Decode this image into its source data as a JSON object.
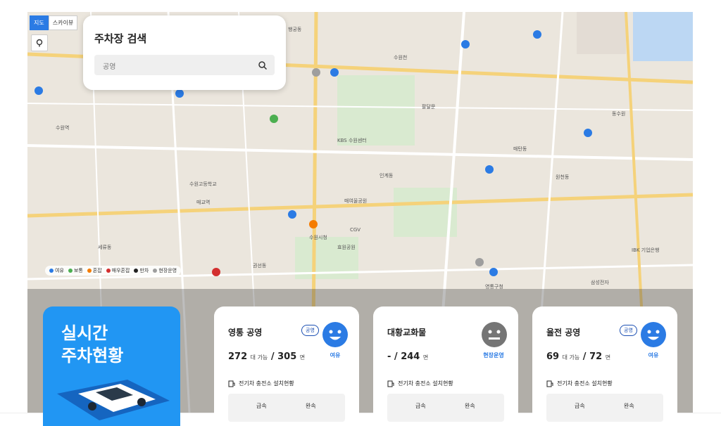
{
  "map_type": {
    "map": "지도",
    "skyview": "스카이뷰"
  },
  "search": {
    "title": "주차장 검색",
    "placeholder": "공영"
  },
  "legend": [
    {
      "label": "여유",
      "color": "#2b7be4"
    },
    {
      "label": "보통",
      "color": "#4caf50"
    },
    {
      "label": "혼잡",
      "color": "#f57c00"
    },
    {
      "label": "매우혼잡",
      "color": "#d32f2f"
    },
    {
      "label": "만차",
      "color": "#222222"
    },
    {
      "label": "현장운영",
      "color": "#9e9e9e"
    }
  ],
  "map_labels": [
    "행궁동",
    "수원천",
    "수원시청",
    "KBS 수원센터",
    "매교역",
    "수원역",
    "인계동",
    "효원공원",
    "매탄동",
    "삼성전자",
    "원천동",
    "팔달문",
    "수원고등학교",
    "매여울공원",
    "세류동",
    "권선동",
    "영통구청",
    "IBK 기업은행",
    "동수원",
    "CGV"
  ],
  "hero": {
    "line1": "실시간",
    "line2": "주차현황"
  },
  "cards": [
    {
      "name": "영통 공영",
      "badge": "공영",
      "available": "272",
      "total": "305",
      "available_unit": "대 가능",
      "total_unit": "면",
      "status": "여유",
      "status_color": "#2b7be4",
      "ev_label": "전기차 충전소 설치현황",
      "col1": "급속",
      "col2": "완속"
    },
    {
      "name": "대황교화물",
      "badge": "",
      "available": "-",
      "total": "244",
      "available_unit": "",
      "total_unit": "면",
      "status": "현장운영",
      "status_color": "#2b7be4",
      "ev_label": "전기차 충전소 설치현황",
      "col1": "급속",
      "col2": "완속"
    },
    {
      "name": "율전 공영",
      "badge": "공영",
      "available": "69",
      "total": "72",
      "available_unit": "대 가능",
      "total_unit": "면",
      "status": "여유",
      "status_color": "#2b7be4",
      "ev_label": "전기차 충전소 설치현황",
      "col1": "급속",
      "col2": "완속"
    }
  ]
}
